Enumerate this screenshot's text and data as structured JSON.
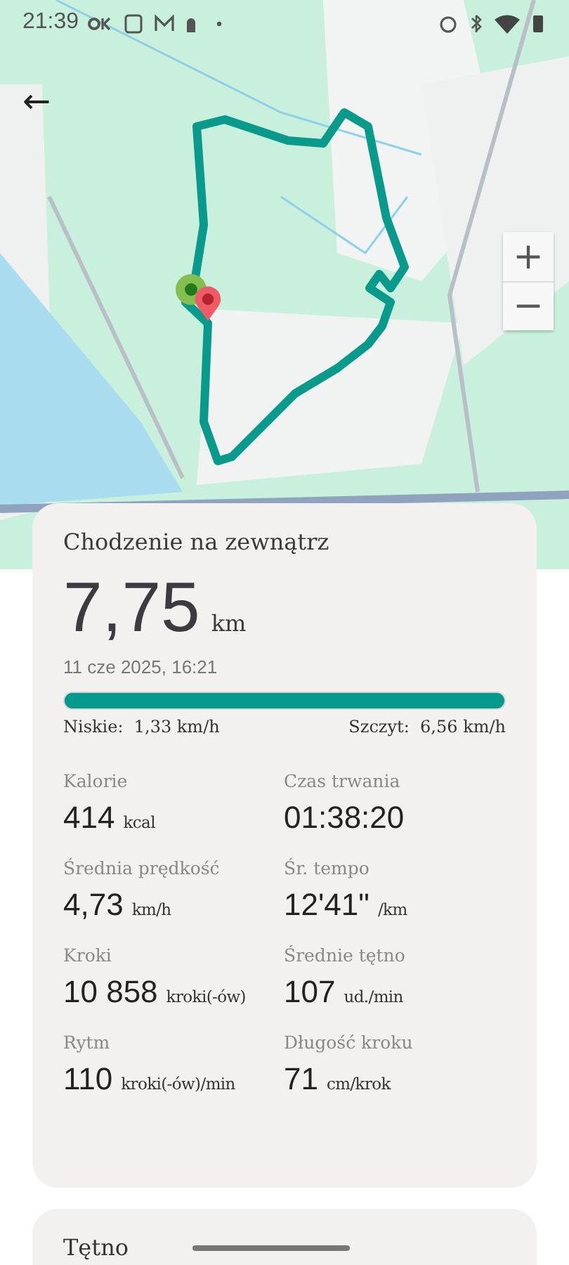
{
  "status_bar": {
    "time": "21:39"
  },
  "map": {
    "back": "←",
    "zoom_in": "+",
    "zoom_out": "−"
  },
  "summary": {
    "title": "Chodzenie na zewnątrz",
    "distance": "7,75",
    "distance_unit": "km",
    "date": "11 cze 2025, 16:21",
    "speed_bar": {
      "level": 1
    },
    "low": {
      "label": "Niskie:",
      "value": "1,33 km/h"
    },
    "peak": {
      "label": "Szczyt:",
      "value": "6,56 km/h"
    },
    "stats": [
      {
        "label": "Kalorie",
        "value": "414",
        "unit": "kcal"
      },
      {
        "label": "Czas trwania",
        "value": "01:38:20"
      },
      {
        "label": "Średnia prędkość",
        "value": "4,73",
        "unit": "km/h"
      },
      {
        "label": "Śr. tempo",
        "value": "12'41\"",
        "unit": "/km"
      },
      {
        "label": "Kroki",
        "value": "10 858",
        "unit": "kroki(-ów)"
      },
      {
        "label": "Średnie tętno",
        "value": "107",
        "unit": "ud./min"
      },
      {
        "label": "Rytm",
        "value": "110",
        "unit": "kroki(-ów)/min"
      },
      {
        "label": "Długość kroku",
        "value": "71",
        "unit": "cm/krok"
      }
    ]
  },
  "heart_rate": {
    "title": "Tętno"
  }
}
